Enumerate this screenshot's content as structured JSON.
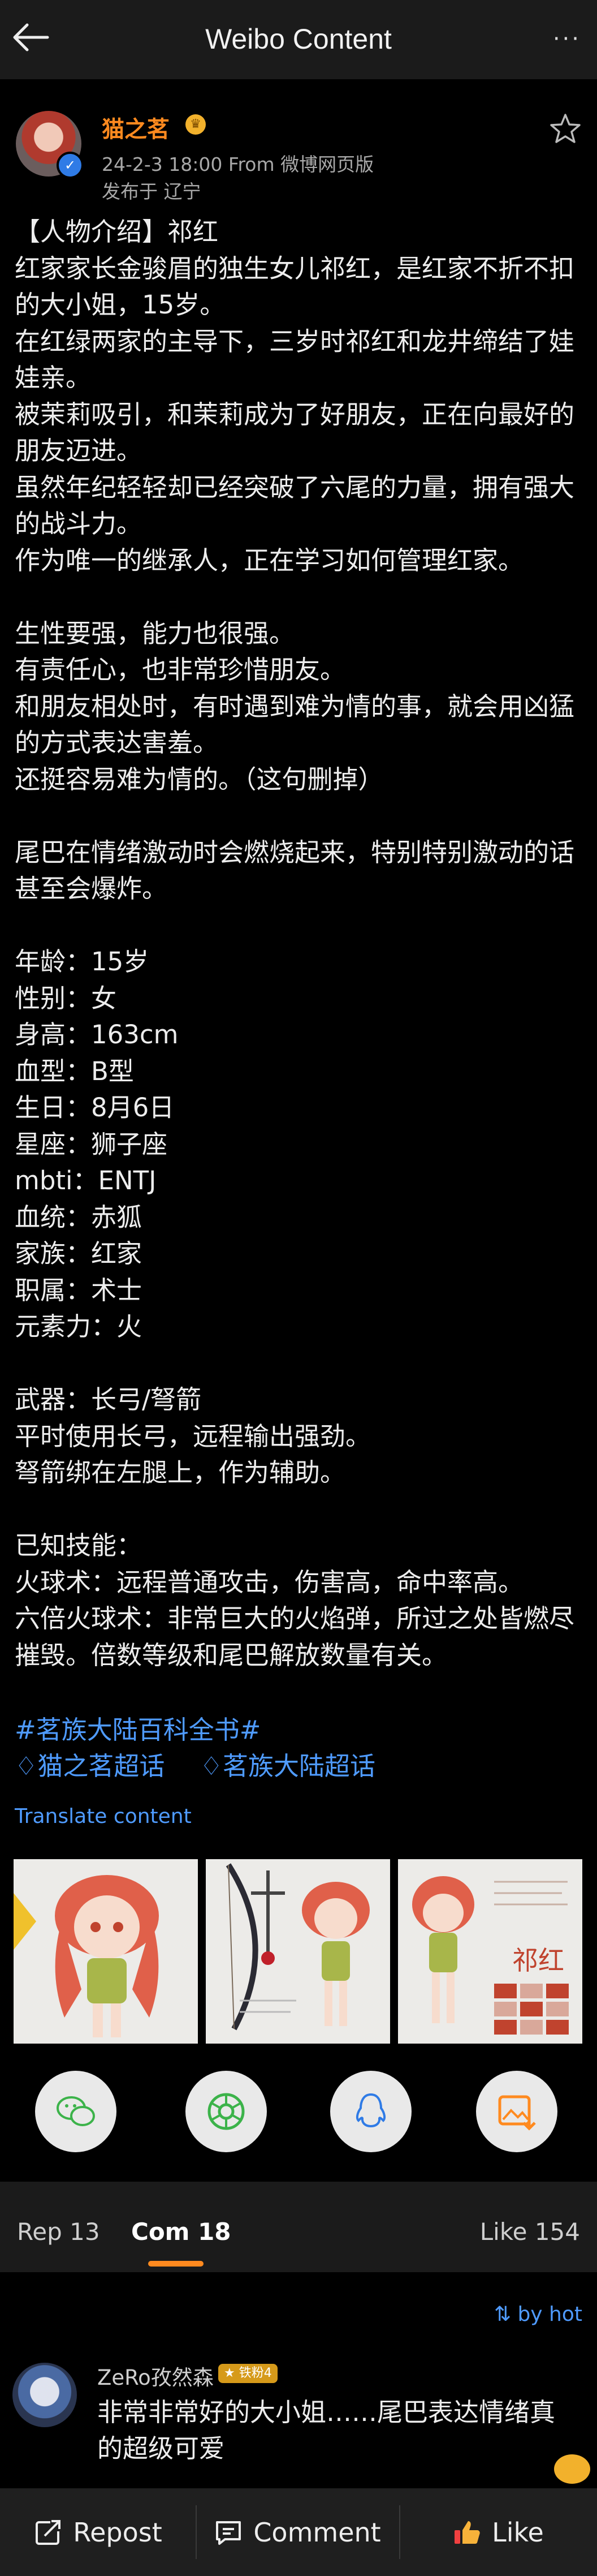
{
  "header": {
    "title": "Weibo Content",
    "more_label": "···"
  },
  "post": {
    "author": "猫之茗",
    "meta": "24-2-3 18:00  From 微博网页版",
    "location": "发布于 辽宁",
    "content_lines": [
      "【人物介绍】祁红",
      "红家家长金骏眉的独生女儿祁红，是红家不折不扣的大小姐，15岁。",
      "在红绿两家的主导下，三岁时祁红和龙井缔结了娃娃亲。",
      "被茉莉吸引，和茉莉成为了好朋友，正在向最好的朋友迈进。",
      "虽然年纪轻轻却已经突破了六尾的力量，拥有强大的战斗力。",
      "作为唯一的继承人，正在学习如何管理红家。",
      "",
      "生性要强，能力也很强。",
      "有责任心，也非常珍惜朋友。",
      "和朋友相处时，有时遇到难为情的事，就会用凶猛的方式表达害羞。",
      "还挺容易难为情的。（这句删掉）",
      "",
      "尾巴在情绪激动时会燃烧起来，特别特别激动的话甚至会爆炸。",
      "",
      "年龄：15岁",
      "性别：女",
      "身高：163cm",
      "血型：B型",
      "生日：8月6日",
      "星座：狮子座",
      "mbti：ENTJ",
      "血统：赤狐",
      "家族：红家",
      "职属：术士",
      "元素力：火",
      "",
      "武器：长弓/弩箭",
      "平时使用长弓，远程输出强劲。",
      "弩箭绑在左腿上，作为辅助。",
      "",
      "已知技能：",
      "火球术：远程普通攻击，伤害高，命中率高。",
      "六倍火球术：非常巨大的火焰弹，所过之处皆燃尽摧毁。倍数等级和尾巴解放数量有关。"
    ],
    "hashtag": "#茗族大陆百科全书#",
    "supertopic_1": "猫之茗超话",
    "supertopic_2": "茗族大陆超话",
    "translate_label": "Translate content",
    "image_3_title": "祁红"
  },
  "tabs": {
    "reposts": "Rep 13",
    "comments": "Com 18",
    "likes": "Like 154"
  },
  "sort_label": "by hot",
  "comment": {
    "author": "ZeRo孜然森",
    "badge": "★ 铁粉4",
    "text": "非常非常好的大小姐……尾巴表达情绪真的超级可爱"
  },
  "bottom": {
    "repost": "Repost",
    "comment": "Comment",
    "like": "Like"
  },
  "colors": {
    "accent": "#ff8a1f",
    "link": "#4f9bff",
    "background": "#000000",
    "bar": "#1b1b1b"
  }
}
